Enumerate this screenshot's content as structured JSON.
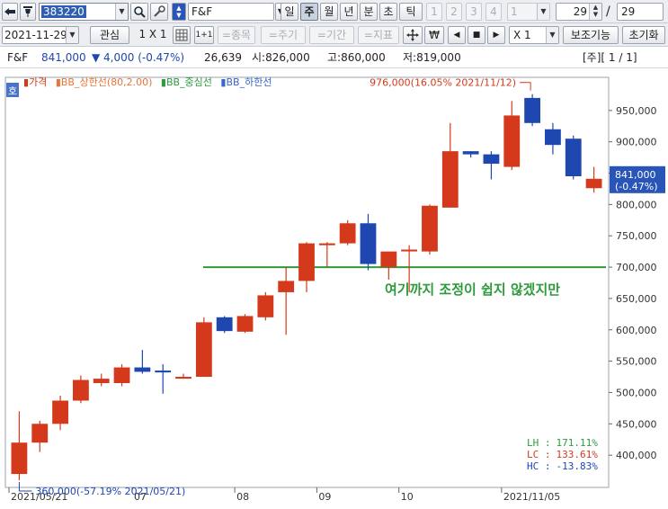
{
  "toolbar": {
    "stock_code": "383220",
    "stock_name": "F&F",
    "period_tabs": [
      "일",
      "주",
      "월",
      "년",
      "분",
      "초",
      "틱"
    ],
    "selected_period": "주",
    "layout_buttons": [
      "1",
      "2",
      "3",
      "4"
    ],
    "layout_select": "1",
    "count_value": "29",
    "count_total": "29",
    "date": "2021-11-29",
    "interest_label": "관심",
    "grid_label": "1 X 1",
    "one_plus_one": "1+1",
    "compare_stock": "=종목",
    "compare_cycle": "=주기",
    "compare_period": "=기간",
    "compare_indicator": "=지표",
    "multiplier": "X 1",
    "aux_function": "보조기능",
    "reset": "초기화",
    "won_symbol": "₩"
  },
  "info": {
    "name": "F&F",
    "price": "841,000",
    "change": "▼ 4,000 (-0.47%)",
    "volume": "26,639",
    "open": "시:826,000",
    "high": "고:860,000",
    "low": "저:819,000",
    "page_indicator": "[주][ 1 / 1]"
  },
  "legend": {
    "quote_badge": "호",
    "items": [
      "가격",
      "BB_상한선(80,2.00)",
      "BB_중심선",
      "BB_하한선"
    ],
    "colors": [
      "#d4391b",
      "#e8753a",
      "#2e9a3c",
      "#3a66c4"
    ]
  },
  "colors": {
    "up": "#d4391b",
    "down": "#1f47b0",
    "trendline": "#2e9a3c",
    "current_price_bg": "#2a55b8"
  },
  "chart_data": {
    "type": "candlestick",
    "interval": "weekly",
    "ylim": [
      360000,
      1000000
    ],
    "y_ticks": [
      {
        "value": 950000,
        "label": "950,000"
      },
      {
        "value": 900000,
        "label": "900,000"
      },
      {
        "value": 850000,
        "label": "850,000"
      },
      {
        "value": 800000,
        "label": "800,000"
      },
      {
        "value": 750000,
        "label": "750,000"
      },
      {
        "value": 700000,
        "label": "700,000"
      },
      {
        "value": 650000,
        "label": "650,000"
      },
      {
        "value": 600000,
        "label": "600,000"
      },
      {
        "value": 550000,
        "label": "550,000"
      },
      {
        "value": 500000,
        "label": "500,000"
      },
      {
        "value": 450000,
        "label": "450,000"
      },
      {
        "value": 400000,
        "label": "400,000"
      }
    ],
    "x_labels": [
      {
        "index": 0,
        "label": "2021/05/21"
      },
      {
        "index": 6,
        "label": "07"
      },
      {
        "index": 11,
        "label": "08"
      },
      {
        "index": 15,
        "label": "09"
      },
      {
        "index": 19,
        "label": "10"
      },
      {
        "index": 24,
        "label": "2021/11/05"
      }
    ],
    "candles": [
      {
        "o": 370000,
        "h": 470000,
        "l": 360000,
        "c": 420000
      },
      {
        "o": 420000,
        "h": 455000,
        "l": 405000,
        "c": 450000
      },
      {
        "o": 450000,
        "h": 495000,
        "l": 440000,
        "c": 487000
      },
      {
        "o": 487000,
        "h": 527000,
        "l": 483000,
        "c": 520000
      },
      {
        "o": 515000,
        "h": 530000,
        "l": 510000,
        "c": 522000
      },
      {
        "o": 515000,
        "h": 545000,
        "l": 510000,
        "c": 540000
      },
      {
        "o": 540000,
        "h": 568000,
        "l": 530000,
        "c": 533000
      },
      {
        "o": 535000,
        "h": 545000,
        "l": 498000,
        "c": 532000
      },
      {
        "o": 522000,
        "h": 530000,
        "l": 522000,
        "c": 525000
      },
      {
        "o": 525000,
        "h": 620000,
        "l": 525000,
        "c": 612000
      },
      {
        "o": 620000,
        "h": 622000,
        "l": 595000,
        "c": 598000
      },
      {
        "o": 597000,
        "h": 625000,
        "l": 595000,
        "c": 622000
      },
      {
        "o": 620000,
        "h": 660000,
        "l": 615000,
        "c": 655000
      },
      {
        "o": 660000,
        "h": 700000,
        "l": 592000,
        "c": 678000
      },
      {
        "o": 678000,
        "h": 740000,
        "l": 660000,
        "c": 738000
      },
      {
        "o": 735000,
        "h": 740000,
        "l": 700000,
        "c": 738000
      },
      {
        "o": 738000,
        "h": 775000,
        "l": 735000,
        "c": 770000
      },
      {
        "o": 770000,
        "h": 785000,
        "l": 695000,
        "c": 705000
      },
      {
        "o": 700000,
        "h": 725000,
        "l": 680000,
        "c": 725000
      },
      {
        "o": 728000,
        "h": 735000,
        "l": 660000,
        "c": 728000
      },
      {
        "o": 725000,
        "h": 800000,
        "l": 720000,
        "c": 798000
      },
      {
        "o": 795000,
        "h": 930000,
        "l": 795000,
        "c": 885000
      },
      {
        "o": 885000,
        "h": 885000,
        "l": 875000,
        "c": 880000
      },
      {
        "o": 880000,
        "h": 885000,
        "l": 840000,
        "c": 865000
      },
      {
        "o": 860000,
        "h": 965000,
        "l": 855000,
        "c": 942000
      },
      {
        "o": 970000,
        "h": 976000,
        "l": 925000,
        "c": 930000
      },
      {
        "o": 920000,
        "h": 930000,
        "l": 880000,
        "c": 895000
      },
      {
        "o": 905000,
        "h": 910000,
        "l": 840000,
        "c": 845000
      },
      {
        "o": 826000,
        "h": 860000,
        "l": 819000,
        "c": 841000
      }
    ],
    "trendline_value": 700000,
    "current_price": {
      "value": 841000,
      "label": "841,000",
      "change": "(-0.47%)"
    },
    "high_annotation": {
      "value": 976000,
      "index": 25,
      "label": "976,000(16.05% 2021/11/12)"
    },
    "low_annotation": {
      "value": 360000,
      "index": 0,
      "label": "360,000(-57.19% 2021/05/21)"
    },
    "annotation_text": "여기까지 조정이 쉽지 않겠지만",
    "stats": [
      {
        "label": "LH :",
        "value": "171.11%",
        "color": "#2e9a3c"
      },
      {
        "label": "LC :",
        "value": "133.61%",
        "color": "#d4391b"
      },
      {
        "label": "HC :",
        "value": "-13.83%",
        "color": "#1f47b0"
      }
    ]
  }
}
